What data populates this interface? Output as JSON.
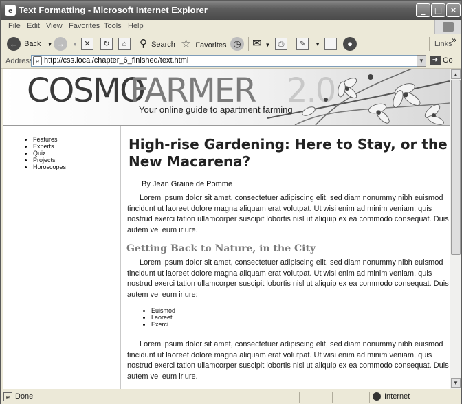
{
  "window": {
    "title": "Text Formatting - Microsoft Internet Explorer"
  },
  "menu": [
    "File",
    "Edit",
    "View",
    "Favorites",
    "Tools",
    "Help"
  ],
  "toolbar": {
    "back_label": "Back",
    "search_label": "Search",
    "favorites_label": "Favorites",
    "links_label": "Links",
    "chevron": "»"
  },
  "address": {
    "label": "Address",
    "url": "http://css.local/chapter_6_finished/text.html",
    "go_label": "Go"
  },
  "banner": {
    "logo_part1": "COSMO",
    "logo_part2": "FARMER",
    "logo_part3": "2.0",
    "tagline": "Your online guide to apartment farming"
  },
  "sidebar": {
    "nav": [
      "Features",
      "Experts",
      "Quiz",
      "Projects",
      "Horoscopes"
    ]
  },
  "article": {
    "headline": "High-rise Gardening: Here to Stay, or the New Macarena?",
    "byline": "By Jean Graine de Pomme",
    "para1": "Lorem ipsum dolor sit amet, consectetuer adipiscing elit, sed diam nonummy nibh euismod tincidunt ut laoreet dolore magna aliquam erat volutpat. Ut wisi enim ad minim veniam, quis nostrud exerci tation ullamcorper suscipit lobortis nisl ut aliquip ex ea commodo consequat. Duis autem vel eum iriure.",
    "subhead": "Getting Back to Nature, in the City",
    "para2": "Lorem ipsum dolor sit amet, consectetuer adipiscing elit, sed diam nonummy nibh euismod tincidunt ut laoreet dolore magna aliquam erat volutpat. Ut wisi enim ad minim veniam, quis nostrud exerci tation ullamcorper suscipit lobortis nisl ut aliquip ex ea commodo consequat. Duis autem vel eum iriure:",
    "list": [
      "Euismod",
      "Laoreet",
      "Exerci"
    ],
    "para3": "Lorem ipsum dolor sit amet, consectetuer adipiscing elit, sed diam nonummy nibh euismod tincidunt ut laoreet dolore magna aliquam erat volutpat. Ut wisi enim ad minim veniam, quis nostrud exerci tation ullamcorper suscipit lobortis nisl ut aliquip ex ea commodo consequat. Duis autem vel eum iriure."
  },
  "status": {
    "text": "Done",
    "zone": "Internet"
  }
}
